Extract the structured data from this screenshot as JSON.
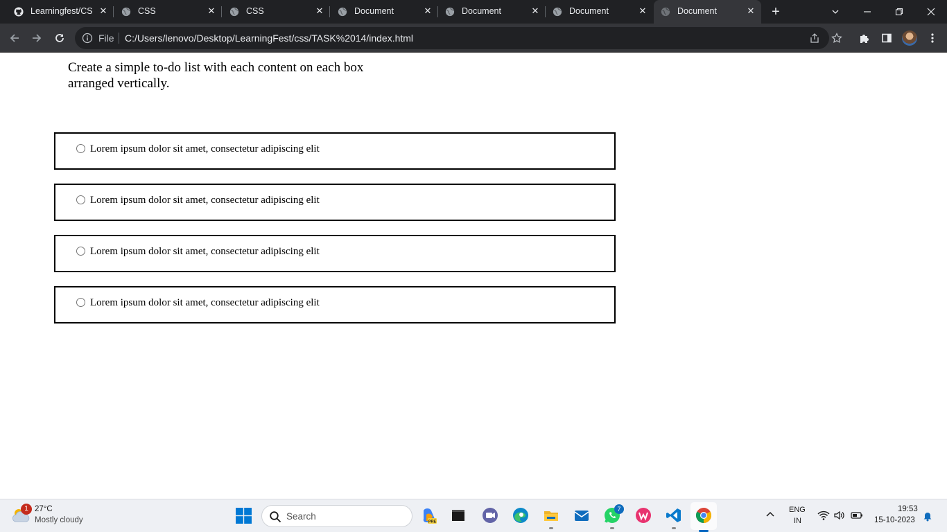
{
  "browser": {
    "tabs": [
      {
        "title": "Learningfest/CSS",
        "favicon": "github-icon",
        "active": false
      },
      {
        "title": "CSS",
        "favicon": "globe-icon",
        "active": false
      },
      {
        "title": "CSS",
        "favicon": "globe-icon",
        "active": false
      },
      {
        "title": "Document",
        "favicon": "globe-icon",
        "active": false
      },
      {
        "title": "Document",
        "favicon": "globe-icon",
        "active": false
      },
      {
        "title": "Document",
        "favicon": "globe-icon",
        "active": false
      },
      {
        "title": "Document",
        "favicon": "globe-icon",
        "active": true
      }
    ],
    "tab_close_glyph": "✕",
    "new_tab_glyph": "+",
    "address": {
      "scheme_label": "File",
      "url": "C:/Users/lenovo/Desktop/LearningFest/css/TASK%2014/index.html"
    },
    "colors": {
      "tabstrip_bg": "#202124",
      "toolbar_bg": "#35363a",
      "omnibox_bg": "#202124",
      "text": "#e8eaed"
    }
  },
  "page": {
    "instructions": "Create a simple to-do list with each content on each box arranged vertically.",
    "todo_items": [
      {
        "label": "Lorem ipsum dolor sit amet, consectetur adipiscing elit",
        "checked": false
      },
      {
        "label": "Lorem ipsum dolor sit amet, consectetur adipiscing elit",
        "checked": false
      },
      {
        "label": "Lorem ipsum dolor sit amet, consectetur adipiscing elit",
        "checked": false
      },
      {
        "label": "Lorem ipsum dolor sit amet, consectetur adipiscing elit",
        "checked": false
      }
    ]
  },
  "taskbar": {
    "weather": {
      "temp": "27°C",
      "condition": "Mostly cloudy",
      "badge": "1"
    },
    "search_placeholder": "Search",
    "apps": [
      "copilot-icon",
      "terminal-icon",
      "teams-icon",
      "edge-icon",
      "file-explorer-icon",
      "mail-icon",
      "whatsapp-icon",
      "wps-office-icon",
      "vscode-icon",
      "chrome-icon"
    ],
    "whatsapp_badge": "7",
    "language": {
      "line1": "ENG",
      "line2": "IN"
    },
    "clock": {
      "time": "19:53",
      "date": "15-10-2023"
    },
    "accent": "#0067c0"
  }
}
